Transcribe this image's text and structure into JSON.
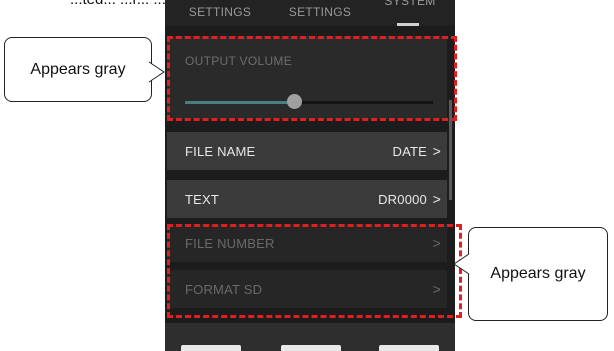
{
  "caption": {
    "partial_text": "...ted... ...r...   ...appear gray."
  },
  "tabs": [
    {
      "label": "SETTINGS"
    },
    {
      "label": "SETTINGS"
    },
    {
      "label": "SYSTEM"
    }
  ],
  "volume": {
    "label": "OUTPUT VOLUME",
    "level_fraction": 0.44
  },
  "rows": [
    {
      "label": "FILE NAME",
      "value": "DATE",
      "chevron": ">",
      "state": "active"
    },
    {
      "label": "TEXT",
      "value": "DR0000",
      "chevron": ">",
      "state": "active"
    },
    {
      "label": "FILE NUMBER",
      "value": "",
      "chevron": ">",
      "state": "dim"
    },
    {
      "label": "FORMAT SD",
      "value": "",
      "chevron": ">",
      "state": "dim"
    }
  ],
  "callouts": [
    {
      "text": "Appears gray"
    },
    {
      "text": "Appears gray"
    }
  ],
  "colors": {
    "highlight": "#e02020",
    "slider_accent": "#4a7c86",
    "screen_bg": "#1c1c1c"
  }
}
